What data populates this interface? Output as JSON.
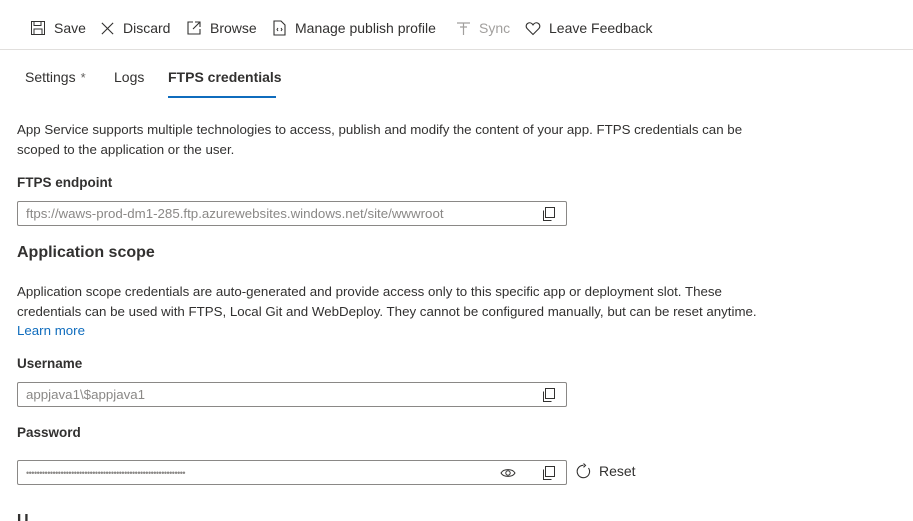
{
  "toolbar": {
    "save": "Save",
    "discard": "Discard",
    "browse": "Browse",
    "manage_publish_profile": "Manage publish profile",
    "sync": "Sync",
    "leave_feedback": "Leave Feedback"
  },
  "tabs": {
    "settings": "Settings",
    "settings_modified_marker": "*",
    "logs": "Logs",
    "ftps_credentials": "FTPS credentials"
  },
  "intro": {
    "text": "App Service supports multiple technologies to access, publish and modify the content of your app. FTPS credentials can be scoped to the application or the user."
  },
  "ftps_endpoint": {
    "label": "FTPS endpoint",
    "value": "ftps://waws-prod-dm1-285.ftp.azurewebsites.windows.net/site/wwwroot"
  },
  "application_scope": {
    "heading": "Application scope",
    "description": "Application scope credentials are auto-generated and provide access only to this specific app or deployment slot. These credentials can be used with FTPS, Local Git and WebDeploy. They cannot be configured manually, but can be reset anytime.",
    "learn_more": "Learn more",
    "username_label": "Username",
    "username_value": "appjava1\\$appjava1",
    "password_label": "Password",
    "password_masked": "••••••••••••••••••••••••••••••••••••••••••••••••••••••••••••",
    "reset": "Reset"
  },
  "next_section_heading_partial": "U"
}
